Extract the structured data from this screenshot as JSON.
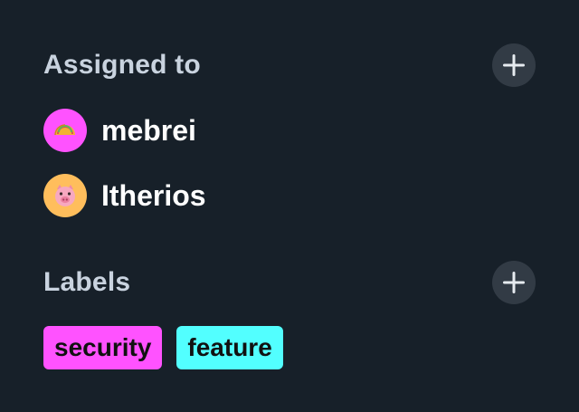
{
  "assigned": {
    "title": "Assigned to",
    "add_icon": "plus-icon",
    "users": [
      {
        "name": "mebrei",
        "avatar_icon": "taco-icon",
        "avatar_color": "#ff52ff"
      },
      {
        "name": "Itherios",
        "avatar_icon": "pig-face-icon",
        "avatar_color": "#ffbe5c"
      }
    ]
  },
  "labels": {
    "title": "Labels",
    "add_icon": "plus-icon",
    "items": [
      {
        "text": "security",
        "color": "#ff52ff"
      },
      {
        "text": "feature",
        "color": "#52ffff"
      }
    ]
  }
}
